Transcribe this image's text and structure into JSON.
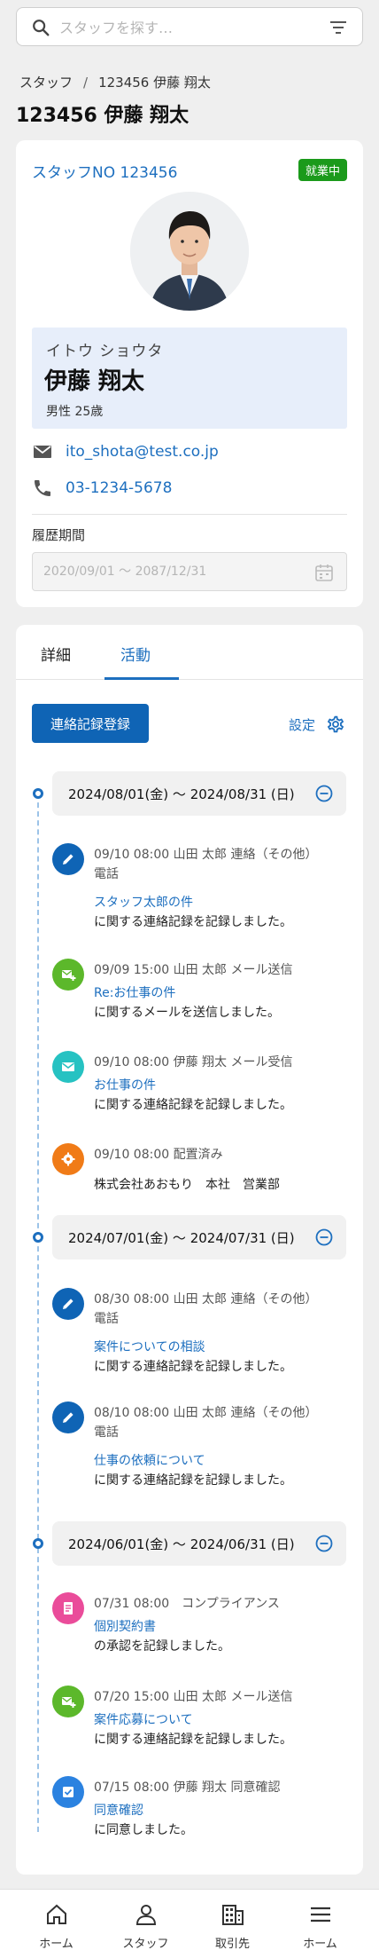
{
  "search": {
    "placeholder": "スタッフを探す…",
    "icon": "search-icon",
    "filter_icon": "filter-icon"
  },
  "breadcrumb": {
    "parent": "スタッフ",
    "separator": "/",
    "current": "123456 伊藤 翔太"
  },
  "page_title": "123456 伊藤 翔太",
  "profile": {
    "staff_no": "スタッフNO 123456",
    "status": "就業中",
    "status_color": "#1b9a1b",
    "kana": "イトウ ショウタ",
    "name": "伊藤 翔太",
    "gender_age": "男性 25歳",
    "email": "ito_shota@test.co.jp",
    "phone": "03-1234-5678",
    "history_label": "履歴期間",
    "history_value": "2020/09/01 〜 2087/12/31"
  },
  "tabs": [
    {
      "label": "詳細"
    },
    {
      "label": "活動"
    }
  ],
  "active_tab": "活動",
  "actions": {
    "register": "連絡記録登録",
    "settings": "設定"
  },
  "accent_color": "#1d6fbf",
  "timeline": [
    {
      "period": "2024/08/01(金) 〜 2024/08/31 (日)",
      "events": [
        {
          "icon": "pencil-icon",
          "color": "#0f64b5",
          "meta": "09/10 08:00 山田 太郎 連絡（その他）",
          "sub": "電話",
          "link": "スタッフ太郎の件",
          "desc": "に関する連絡記録を記録しました。"
        },
        {
          "icon": "mail-add-icon",
          "color": "#5cb82b",
          "meta": "09/09 15:00 山田 太郎 メール送信",
          "sub": "",
          "link": "Re:お仕事の件",
          "desc": "に関するメールを送信しました。"
        },
        {
          "icon": "mail-icon",
          "color": "#26c2c2",
          "meta": "09/10 08:00 伊藤 翔太 メール受信",
          "sub": "",
          "link": "お仕事の件",
          "desc": "に関する連絡記録を記録しました。"
        },
        {
          "icon": "gear-icon",
          "color": "#f07b17",
          "meta": "09/10 08:00 配置済み",
          "sub": "",
          "link": "",
          "desc": "株式会社あおもり　本社　営業部"
        }
      ]
    },
    {
      "period": "2024/07/01(金) 〜 2024/07/31 (日)",
      "events": [
        {
          "icon": "pencil-icon",
          "color": "#0f64b5",
          "meta": "08/30 08:00 山田 太郎 連絡（その他）",
          "sub": "電話",
          "link": "案件についての相談",
          "desc": "に関する連絡記録を記録しました。"
        },
        {
          "icon": "pencil-icon",
          "color": "#0f64b5",
          "meta": "08/10 08:00 山田 太郎 連絡（その他）",
          "sub": "電話",
          "link": "仕事の依頼について",
          "desc": "に関する連絡記録を記録しました。"
        }
      ]
    },
    {
      "period": "2024/06/01(金) 〜 2024/06/31 (日)",
      "events": [
        {
          "icon": "contract-icon",
          "color": "#ea4c9a",
          "meta": "07/31 08:00　コンプライアンス",
          "sub": "",
          "link": "個別契約書",
          "desc": "の承認を記録しました。"
        },
        {
          "icon": "mail-add-icon",
          "color": "#5cb82b",
          "meta": "07/20 15:00 山田 太郎 メール送信",
          "sub": "",
          "link": "案件応募について",
          "desc": "に関する連絡記録を記録しました。"
        },
        {
          "icon": "check-icon",
          "color": "#2b82e0",
          "meta": "07/15 08:00 伊藤 翔太 同意確認",
          "sub": "",
          "link": "同意確認",
          "desc": "に同意しました。"
        }
      ]
    }
  ],
  "bottom_nav": [
    {
      "label": "ホーム",
      "icon": "home-icon"
    },
    {
      "label": "スタッフ",
      "icon": "person-icon"
    },
    {
      "label": "取引先",
      "icon": "building-icon"
    },
    {
      "label": "ホーム",
      "icon": "menu-icon"
    }
  ]
}
